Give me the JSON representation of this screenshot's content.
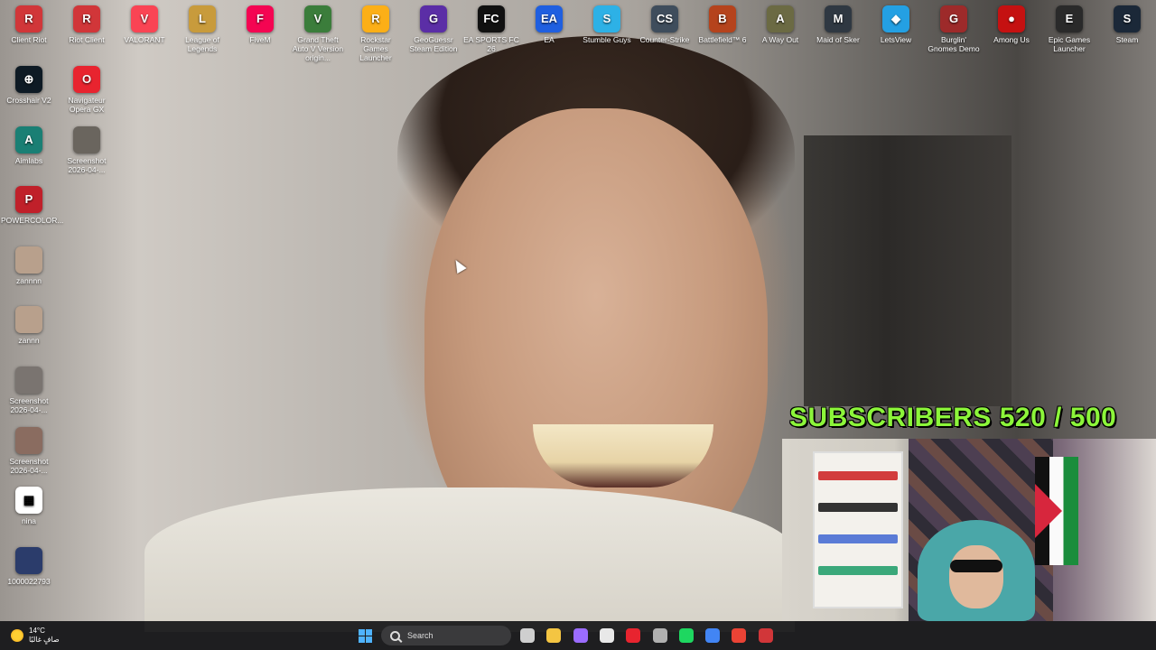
{
  "desktop": {
    "top_icons": [
      {
        "label": "Client Riot",
        "color": "#d13639",
        "glyph": "R"
      },
      {
        "label": "Riot Client",
        "color": "#d13639",
        "glyph": "R"
      },
      {
        "label": "VALORANT",
        "color": "#fa4454",
        "glyph": "V"
      },
      {
        "label": "League of Legends",
        "color": "#c89b3c",
        "glyph": "L"
      },
      {
        "label": "FiveM",
        "color": "#f40552",
        "glyph": "F"
      },
      {
        "label": "Grand Theft Auto V Version origin...",
        "color": "#3b7d3b",
        "glyph": "V"
      },
      {
        "label": "Rockstar Games Launcher",
        "color": "#fcaf17",
        "glyph": "R"
      },
      {
        "label": "GeoGuessr Steam Edition",
        "color": "#5b2ea6",
        "glyph": "G"
      },
      {
        "label": "EA SPORTS FC 26",
        "color": "#111111",
        "glyph": "FC"
      },
      {
        "label": "EA",
        "color": "#1f5fe0",
        "glyph": "EA"
      },
      {
        "label": "Stumble Guys",
        "color": "#2db1e6",
        "glyph": "S"
      },
      {
        "label": "Counter-Strike",
        "color": "#3f4d5c",
        "glyph": "CS"
      },
      {
        "label": "Battlefield™ 6",
        "color": "#b5431c",
        "glyph": "B"
      },
      {
        "label": "A Way Out",
        "color": "#6b6a43",
        "glyph": "A"
      },
      {
        "label": "Maid of Sker",
        "color": "#2f3842",
        "glyph": "M"
      },
      {
        "label": "LetsView",
        "color": "#24a0e3",
        "glyph": "◆"
      },
      {
        "label": "Burglin' Gnomes Demo",
        "color": "#9d2a2a",
        "glyph": "G"
      },
      {
        "label": "Among Us",
        "color": "#c51111",
        "glyph": "●"
      },
      {
        "label": "Epic Games Launcher",
        "color": "#2a2a2a",
        "glyph": "E"
      },
      {
        "label": "Steam",
        "color": "#1b2838",
        "glyph": "S"
      }
    ],
    "side_icons_col1": [
      {
        "label": "Crosshair V2",
        "color": "#0e1a24",
        "glyph": "⊕"
      },
      {
        "label": "Aimlabs",
        "color": "#1a7f74",
        "glyph": "A"
      },
      {
        "label": "POWERCOLOR...",
        "color": "#c0202a",
        "glyph": "P"
      },
      {
        "label": "zannnn",
        "color": "#b8a08c",
        "glyph": ""
      },
      {
        "label": "zannn",
        "color": "#b8a08c",
        "glyph": ""
      },
      {
        "label": "Screenshot 2026-04-...",
        "color": "#7a7470",
        "glyph": ""
      },
      {
        "label": "Screenshot 2026-04-...",
        "color": "#8a6c60",
        "glyph": ""
      },
      {
        "label": "nina",
        "color": "#ffffff",
        "glyph": "▦"
      },
      {
        "label": "1000022793",
        "color": "#2b3c6b",
        "glyph": ""
      }
    ],
    "side_icons_col2": [
      {
        "label": "Navigateur Opera GX",
        "color": "#e8242f",
        "glyph": "O"
      },
      {
        "label": "Screenshot 2026-04-...",
        "color": "#6a655e",
        "glyph": ""
      }
    ]
  },
  "overlay": {
    "subscribers_text": "SUBSCRIBERS 520 / 500",
    "color": "#8cf53a"
  },
  "taskbar": {
    "weather_temp": "14°C",
    "weather_desc": "صافٍ غالبًا",
    "search_placeholder": "Search",
    "apps": [
      {
        "name": "task-view-icon",
        "color": "#cfcfcf"
      },
      {
        "name": "file-explorer-icon",
        "color": "#f4c542"
      },
      {
        "name": "copilot-icon",
        "color": "#9b6cff"
      },
      {
        "name": "microsoft-store-icon",
        "color": "#e8e8e8"
      },
      {
        "name": "opera-gx-icon",
        "color": "#e8242f"
      },
      {
        "name": "settings-icon",
        "color": "#b0b0b0"
      },
      {
        "name": "spotify-icon",
        "color": "#1ed760"
      },
      {
        "name": "chrome-icon",
        "color": "#4285f4"
      },
      {
        "name": "chrome-profile-icon",
        "color": "#ea4335"
      },
      {
        "name": "riot-client-icon",
        "color": "#d13639"
      }
    ]
  }
}
